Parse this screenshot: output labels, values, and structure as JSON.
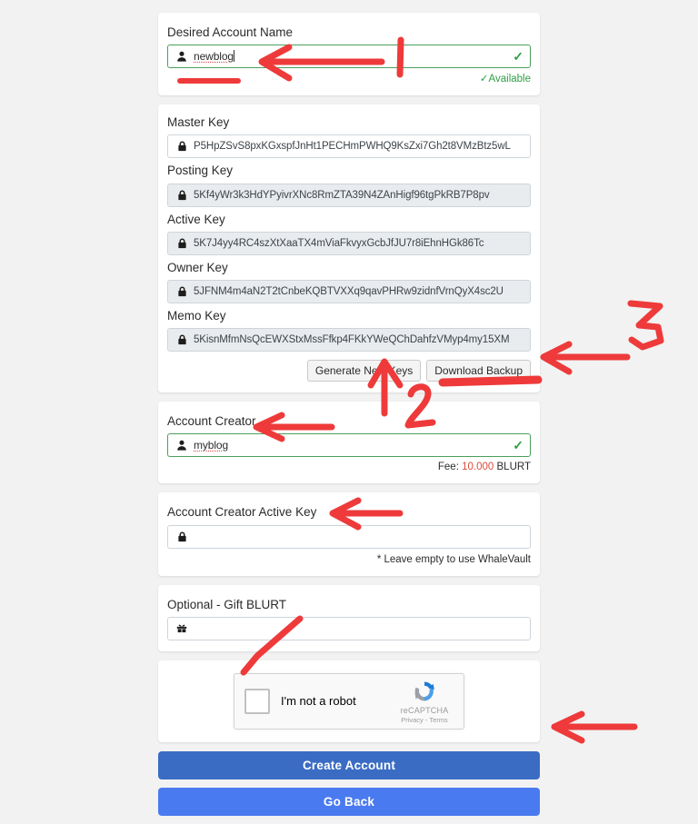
{
  "form": {
    "desired_account": {
      "label": "Desired Account Name",
      "value": "newblog",
      "status": "Available",
      "user_icon": "user-icon",
      "check_icon": "check-icon"
    },
    "keys": {
      "master": {
        "label": "Master Key",
        "value": "P5HpZSvS8pxKGxspfJnHt1PECHmPWHQ9KsZxi7Gh2t8VMzBtz5wL"
      },
      "posting": {
        "label": "Posting Key",
        "value": "5Kf4yWr3k3HdYPyivrXNc8RmZTA39N4ZAnHigf96tgPkRB7P8pv"
      },
      "active": {
        "label": "Active Key",
        "value": "5K7J4yy4RC4szXtXaaTX4mViaFkvyxGcbJfJU7r8iEhnHGk86Tc"
      },
      "owner": {
        "label": "Owner Key",
        "value": "5JFNM4m4aN2T2tCnbeKQBTVXXq9qavPHRw9zidnfVrnQyX4sc2U"
      },
      "memo": {
        "label": "Memo Key",
        "value": "5KisnMfmNsQcEWXStxMssFfkp4FKkYWeQChDahfzVMyp4my15XM"
      },
      "generate_button": "Generate New Keys",
      "download_button": "Download Backup",
      "lock_icon": "lock-icon"
    },
    "account_creator": {
      "label": "Account Creator",
      "value": "myblog",
      "fee_prefix": "Fee:",
      "fee_amount": "10.000",
      "fee_currency": "BLURT"
    },
    "creator_active_key": {
      "label": "Account Creator Active Key",
      "value": "",
      "note": "* Leave empty to use WhaleVault"
    },
    "gift": {
      "label": "Optional - Gift BLURT",
      "value": "",
      "icon": "gift-icon"
    },
    "captcha": {
      "checkbox_label": "I'm not a robot",
      "brand": "reCAPTCHA",
      "privacy": "Privacy",
      "separator": "-",
      "terms": "Terms"
    },
    "actions": {
      "create": "Create Account",
      "back": "Go Back"
    }
  },
  "annotations": {
    "marker_2": "2",
    "marker_3": "3",
    "color": "#ee3a3a"
  },
  "colors": {
    "page_background": "#f2f2f2",
    "card": "#ffffff",
    "valid_border": "#4aa05a",
    "available_text": "#2f9e44",
    "fee_amount": "#d94c3d",
    "primary_button": "#3b6cc4",
    "secondary_button": "#4a7af0",
    "annotation_red": "#ee3a3a"
  }
}
